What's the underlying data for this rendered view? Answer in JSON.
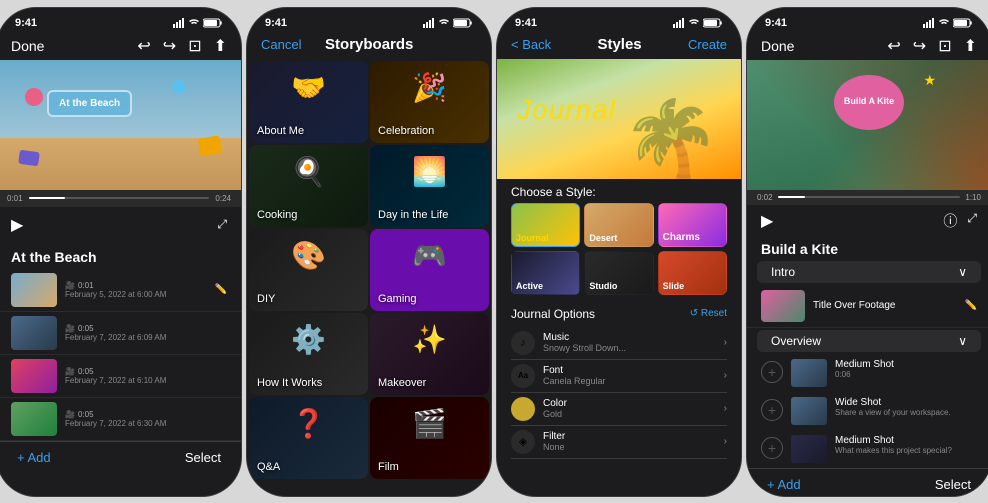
{
  "phones": [
    {
      "id": "phone1",
      "status_time": "9:41",
      "nav": {
        "done_label": "Done",
        "icons": [
          "undo-icon",
          "redo-icon",
          "storyboard-icon",
          "share-icon"
        ]
      },
      "video": {
        "title_card": "At the Beach",
        "start_time": "0:01",
        "end_time": "0:24"
      },
      "section_title": "At the Beach",
      "clips": [
        {
          "thumb_class": "clip-thumb-beach",
          "icon": "🎥",
          "duration": "0:01",
          "date": "February 5, 2022 at 6:00 AM"
        },
        {
          "thumb_class": "clip-thumb-street",
          "icon": "🎥",
          "duration": "0:05",
          "date": "February 7, 2022 at 6:09 AM"
        },
        {
          "thumb_class": "clip-thumb-mural",
          "icon": "🎥",
          "duration": "0:05",
          "date": "February 7, 2022 at 6:10 AM"
        },
        {
          "thumb_class": "clip-thumb-shoes",
          "icon": "🎥",
          "duration": "0:05",
          "date": "February 7, 2022 at 6:30 AM"
        }
      ],
      "bottom": {
        "add_label": "+ Add",
        "select_label": "Select"
      }
    },
    {
      "id": "phone2",
      "status_time": "9:41",
      "header": {
        "cancel_label": "Cancel",
        "title": "Storyboards"
      },
      "categories": [
        {
          "label": "About Me",
          "icon": "🤝",
          "class": "sb-about"
        },
        {
          "label": "Celebration",
          "icon": "🎉",
          "class": "sb-celebration"
        },
        {
          "label": "Cooking",
          "icon": "🍳",
          "class": "sb-cooking"
        },
        {
          "label": "Day in the Life",
          "icon": "🌅",
          "class": "sb-daylife"
        },
        {
          "label": "DIY",
          "icon": "🎨",
          "class": "sb-diy"
        },
        {
          "label": "Gaming",
          "icon": "🎮",
          "class": "sb-gaming"
        },
        {
          "label": "How It Works",
          "icon": "⚙️",
          "class": "sb-howworks"
        },
        {
          "label": "Makeover",
          "icon": "✨",
          "class": "sb-makeover"
        },
        {
          "label": "Q&A",
          "icon": "❓",
          "class": "sb-qa"
        },
        {
          "label": "Film",
          "icon": "🎬",
          "class": "sb-film"
        }
      ]
    },
    {
      "id": "phone3",
      "status_time": "9:41",
      "header": {
        "back_label": "< Back",
        "title": "Styles",
        "create_label": "Create"
      },
      "journal_title": "Journal",
      "choose_style_label": "Choose a Style:",
      "styles": [
        {
          "label": "Journal",
          "class": "st-journal",
          "text_color": "#FFD700"
        },
        {
          "label": "Desert",
          "class": "st-desert",
          "text_color": "#fff"
        },
        {
          "label": "Charms",
          "class": "st-charms",
          "text_color": "#fff"
        },
        {
          "label": "Active",
          "class": "st-active",
          "text_color": "#fff"
        },
        {
          "label": "Studio",
          "class": "st-studio",
          "text_color": "#fff"
        },
        {
          "label": "Slide",
          "class": "st-slide",
          "text_color": "#fff"
        }
      ],
      "options": {
        "title": "Journal Options",
        "reset_label": "↺ Reset",
        "items": [
          {
            "icon": "♪",
            "label": "Music",
            "value": "Snowy Stroll Down..."
          },
          {
            "icon": "Aa",
            "label": "Font",
            "value": "Canela Regular"
          },
          {
            "icon": "●",
            "label": "Color",
            "value": "Gold"
          },
          {
            "icon": "◈",
            "label": "Filter",
            "value": "None"
          }
        ]
      }
    },
    {
      "id": "phone4",
      "status_time": "9:41",
      "nav": {
        "done_label": "Done",
        "icons": [
          "undo-icon",
          "redo-icon",
          "storyboard-icon",
          "share-icon"
        ]
      },
      "kite_title": "Build A Kite",
      "video": {
        "start_time": "0:02",
        "end_time": "1:10"
      },
      "project_title": "Build a Kite",
      "segments": [
        {
          "label": "Intro",
          "items": [
            {
              "name": "Title Over Footage",
              "thumb_class": "storyboard-thumb"
            }
          ]
        },
        {
          "label": "Overview",
          "items": [
            {
              "name": "Medium Shot",
              "desc": "0:06",
              "thumb_class": "ov-desk"
            },
            {
              "name": "Wide Shot",
              "desc": "Share a view of your workspace.",
              "thumb_class": "ov-desk"
            },
            {
              "name": "Medium Shot",
              "desc": "What makes this project special?",
              "thumb_class": "ov-person"
            }
          ]
        }
      ],
      "bottom": {
        "add_label": "+ Add",
        "select_label": "Select"
      }
    }
  ]
}
